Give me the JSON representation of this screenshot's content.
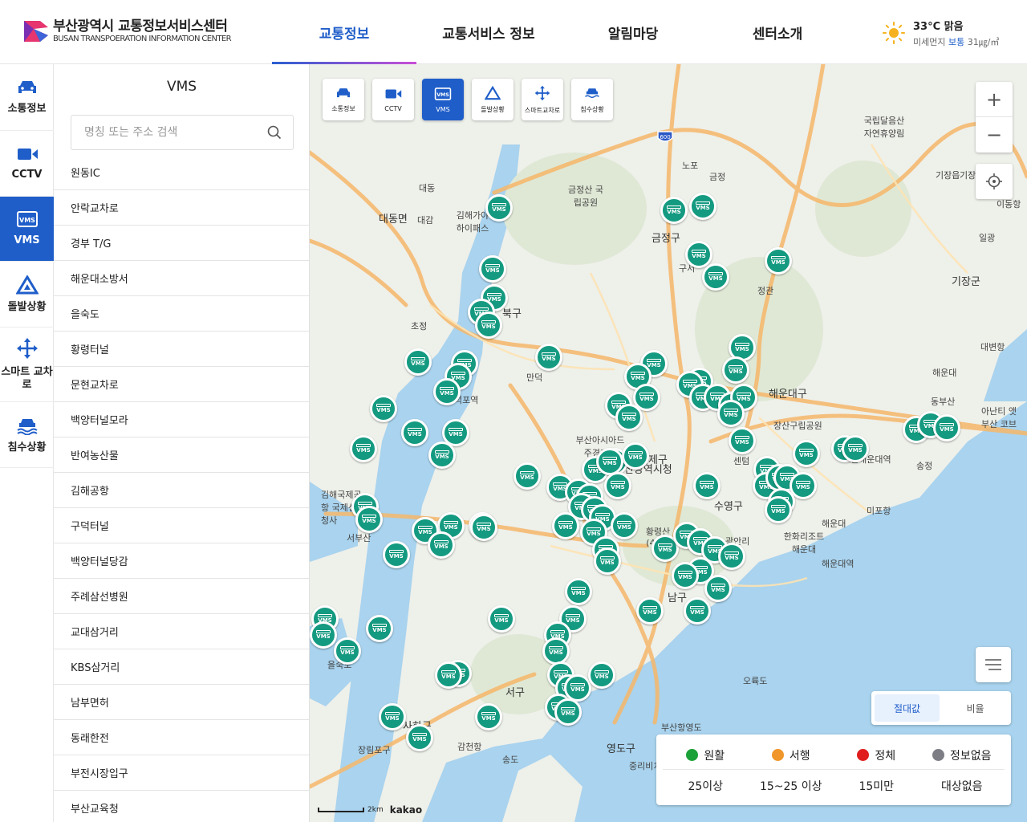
{
  "header": {
    "logo_ko": "부산광역시 교통정보서비스센터",
    "logo_en": "BUSAN TRANSPOERATION INFORMATION CENTER",
    "nav": [
      "교통정보",
      "교통서비스 정보",
      "알림마당",
      "센터소개"
    ],
    "weather": {
      "temp": "33°C 맑음",
      "dust_label": "미세먼지",
      "dust_grade": "보통",
      "dust_value": "31㎍/㎥"
    }
  },
  "rail": [
    "소통정보",
    "CCTV",
    "VMS",
    "돌발상황",
    "스마트 교차로",
    "침수상황"
  ],
  "panel": {
    "title": "VMS",
    "search_placeholder": "명칭 또는 주소 검색",
    "items": [
      "원동IC",
      "안락교차로",
      "경부 T/G",
      "해운대소방서",
      "을숙도",
      "황령터널",
      "문현교차로",
      "백양터널모라",
      "반여농산물",
      "김해공항",
      "구덕터널",
      "백양터널당감",
      "주례삼선병원",
      "교대삼거리",
      "KBS삼거리",
      "남부면허",
      "동래한전",
      "부전시장입구",
      "부산교육청"
    ]
  },
  "map": {
    "toolbar": [
      "소통정보",
      "CCTV",
      "VMS",
      "돌발상황",
      "스마트교차로",
      "침수상황"
    ],
    "marker_label": "VMS",
    "place_labels": [
      "대동면",
      "금정구",
      "북구",
      "기장군",
      "해운대구",
      "연제구",
      "수영구",
      "남구",
      "서구",
      "영도구",
      "사하구",
      "금정산 국립공원",
      "장산구립공원",
      "국립달음산 자연휴양림",
      "을숙도",
      "김해국제공항 국제선청사",
      "오륙도",
      "송도",
      "송정",
      "미포항",
      "해운대",
      "광안리",
      "한화리조트 해운대",
      "센텀",
      "만덕",
      "금정",
      "노포",
      "구서",
      "대감",
      "대동",
      "초정",
      "기장",
      "일광",
      "정관",
      "대변항",
      "황령산 (427)",
      "감천항",
      "부산항영도",
      "장림포구",
      "서부산",
      "덕포역",
      "중리비치",
      "부산아시아드 주경기장",
      "김해가야 하이패스",
      "기장읍",
      "동부산",
      "아난티 앳 부산 코브",
      "해운대",
      "이동항",
      "해운대역",
      "신해운대역",
      "부산광역시청"
    ],
    "mode": [
      "절대값",
      "비율"
    ],
    "legend": [
      {
        "name": "원활",
        "range": "25이상",
        "color": "#1aa137"
      },
      {
        "name": "서행",
        "range": "15~25 이상",
        "color": "#f0962a"
      },
      {
        "name": "정체",
        "range": "15미만",
        "color": "#e01e1e"
      },
      {
        "name": "정보없음",
        "range": "대상없음",
        "color": "#7d7d86"
      }
    ],
    "scale": "2km",
    "attribution": "kakao",
    "road_shield": "600"
  },
  "colors": {
    "accent": "#1f5ec9",
    "vms_marker": "#149a80"
  }
}
